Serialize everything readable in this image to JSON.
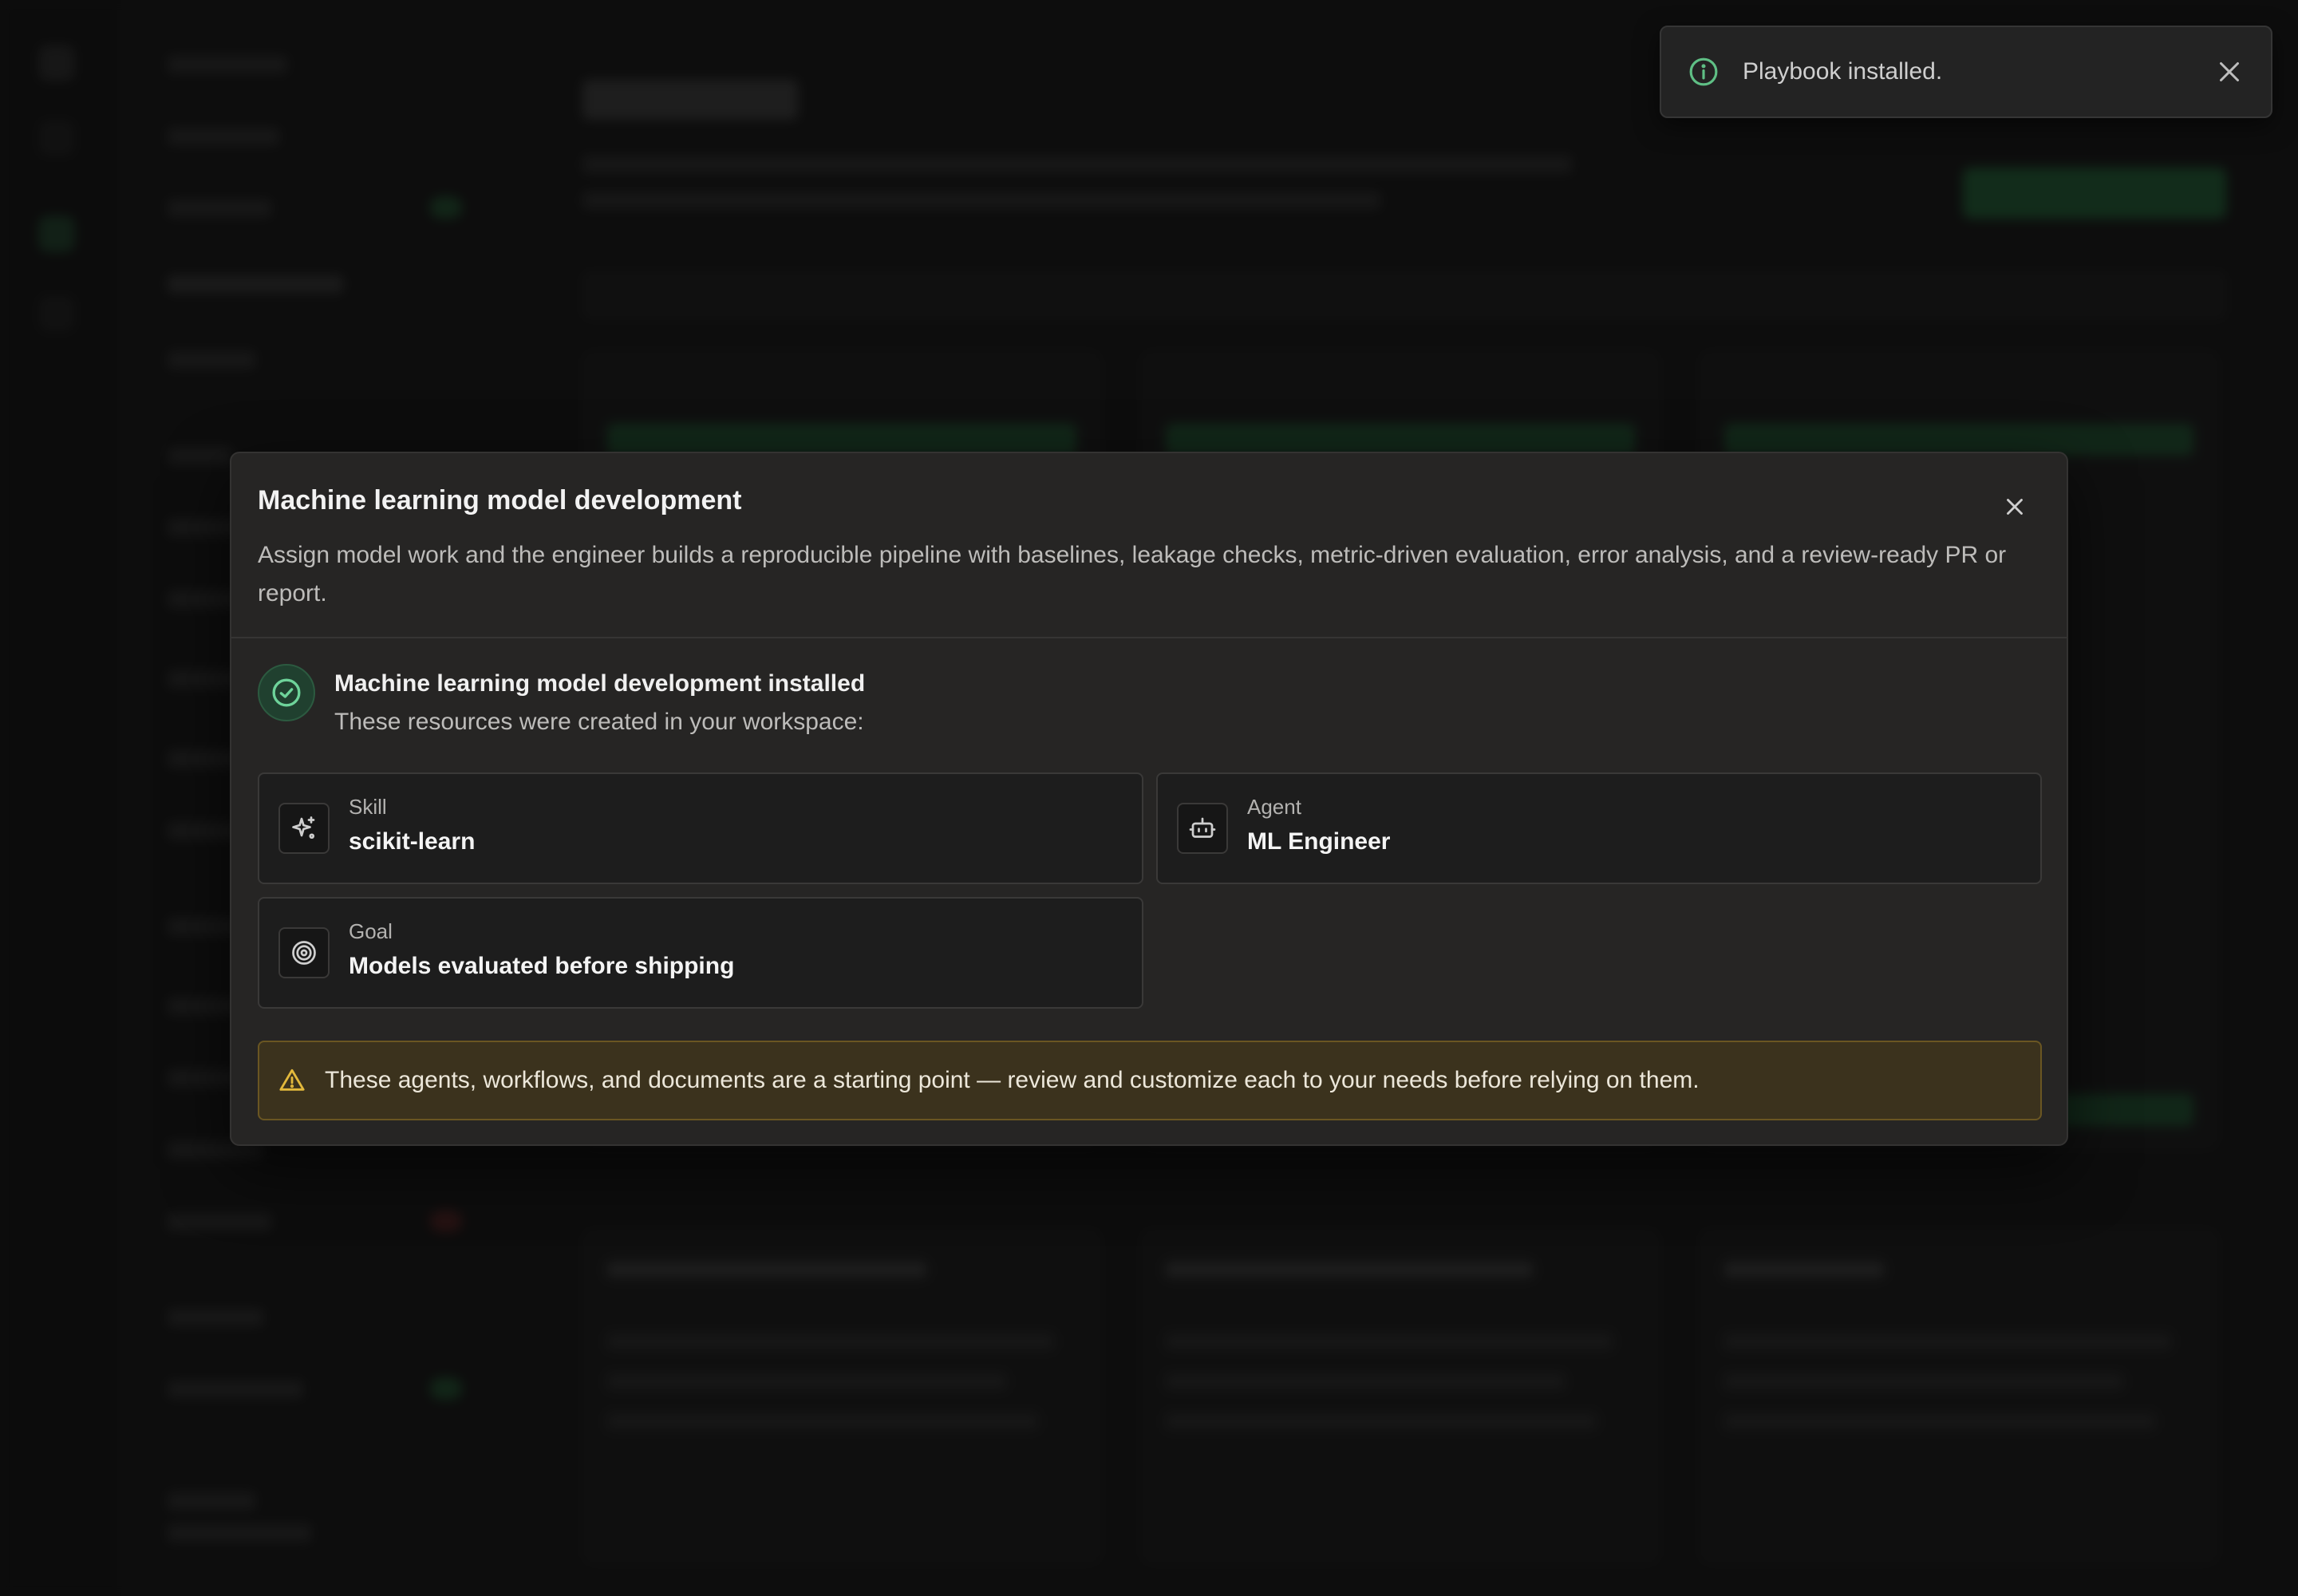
{
  "toast": {
    "message": "Playbook installed.",
    "icon": "info-icon",
    "close_icon": "close-icon"
  },
  "modal": {
    "title": "Machine learning model development",
    "description": "Assign model work and the engineer builds a reproducible pipeline with baselines, leakage checks, metric-driven evaluation, error analysis, and a review-ready PR or report.",
    "installed": {
      "title": "Machine learning model development installed",
      "subtitle": "These resources were created in your workspace:"
    },
    "resources": [
      {
        "kind": "Skill",
        "name": "scikit-learn",
        "icon": "sparkle-icon"
      },
      {
        "kind": "Agent",
        "name": "ML Engineer",
        "icon": "robot-icon"
      },
      {
        "kind": "Goal",
        "name": "Models evaluated before shipping",
        "icon": "target-icon"
      }
    ],
    "warning": "These agents, workflows, and documents are a starting point — review and customize each to your needs before relying on them."
  },
  "colors": {
    "accent_green": "#5fbf85",
    "warning_yellow": "#e3b93c",
    "modal_bg": "#262524"
  }
}
